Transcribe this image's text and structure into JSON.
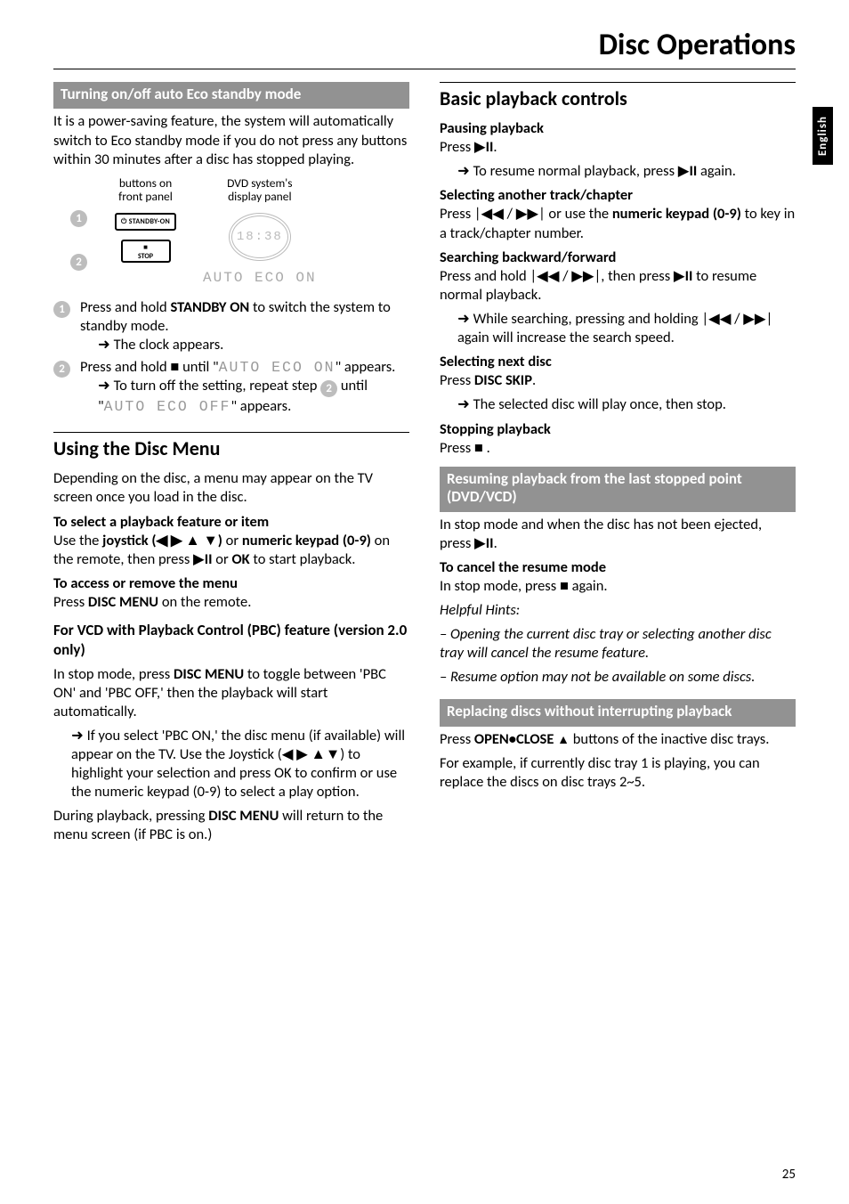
{
  "page_title": "Disc Operations",
  "side_tab": "English",
  "page_number": "25",
  "left": {
    "eco_head": "Turning on/off auto Eco standby mode",
    "eco_intro": "It is a power-saving feature, the system will automatically switch to Eco standby mode if you do not press any buttons within 30 minutes after a disc has stopped playing.",
    "diag_label_left_1": "buttons on",
    "diag_label_left_2": "front panel",
    "diag_label_right_1": "DVD system's",
    "diag_label_right_2": "display panel",
    "standby_btn": "STANDBY-ON",
    "stop_btn_top": "■",
    "stop_btn_bottom": "STOP",
    "clock_display": "18:38",
    "auto_eco_display": "AUTO ECO ON",
    "step1_a": "Press and hold ",
    "step1_b": "STANDBY ON",
    "step1_c": " to switch the system to standby mode.",
    "step1_result": "The clock appears.",
    "step2_a": "Press and hold  ■  until \"",
    "step2_seg": "AUTO ECO ON",
    "step2_b": "\" appears.",
    "step2_result_a": "To turn off the setting, repeat step ",
    "step2_result_b": " until \"",
    "step2_result_seg": "AUTO ECO OFF",
    "step2_result_c": "\" appears.",
    "disc_menu_title": "Using the Disc Menu",
    "dm_intro": "Depending on the disc, a menu may appear on the TV screen once you load in the disc.",
    "dm_select_head": "To select a playback feature or item",
    "dm_select_a": "Use the ",
    "dm_select_joy": "joystick (◀ ▶ ▲ ▼)",
    "dm_select_b": " or ",
    "dm_select_kp": "numeric keypad (0-9)",
    "dm_select_c": " on the remote, then press  ▶",
    "dm_select_d": " or ",
    "dm_select_ok": "OK",
    "dm_select_e": " to start playback.",
    "dm_access_head": "To access or remove the menu",
    "dm_access_a": "Press ",
    "dm_access_b": "DISC MENU",
    "dm_access_c": " on the remote.",
    "pbc_head": "For VCD with Playback Control (PBC) feature (version 2.0 only)",
    "pbc_a": "In stop mode, press ",
    "pbc_b": "DISC MENU",
    "pbc_c": " to toggle between 'PBC ON' and 'PBC OFF,' then the playback will start automatically.",
    "pbc_d": "If you select 'PBC ON,' the disc menu (if available) will appear on the TV.  Use the Joystick (◀ ▶ ▲▼) to highlight your selection and press OK to confirm or use the numeric keypad (0-9) to select a play option.",
    "pbc_e1": "During playback, pressing ",
    "pbc_e2": "DISC MENU",
    "pbc_e3": " will return to the menu screen (if PBC is on.)"
  },
  "right": {
    "basic_title": "Basic playback controls",
    "pause_head": "Pausing playback",
    "pause_a": "Press  ▶",
    "pause_b": ".",
    "pause_c": "To resume normal playback, press ▶",
    "pause_d": " again.",
    "seltrack_head": "Selecting another track/chapter",
    "seltrack_a": "Press ",
    "seltrack_keys": "|◀◀ / ▶▶|",
    "seltrack_b": " or use the ",
    "seltrack_kp": "numeric keypad (0-9)",
    "seltrack_c": " to key in a track/chapter number.",
    "search_head": "Searching backward/forward",
    "search_a": "Press and hold ",
    "search_keys": "|◀◀ / ▶▶|",
    "search_b": ", then press ▶",
    "search_c": " to resume normal playback.",
    "search_d": "While searching, pressing and holding ",
    "search_keys2": "|◀◀ / ▶▶|",
    "search_e": " again will increase the search speed.",
    "next_head": "Selecting next disc",
    "next_a": "Press ",
    "next_b": "DISC SKIP",
    "next_c": ".",
    "next_d": "The selected disc will play once, then stop.",
    "stop_head": "Stopping playback",
    "stop_a": "Press  ■ .",
    "resume_head": "Resuming playback from the last stopped point (DVD/VCD)",
    "resume_a": "In stop mode and when the disc has not been ejected, press  ▶",
    "resume_b": ".",
    "cancel_head": "To cancel the resume mode",
    "cancel_a": "In stop mode, press  ■  again.",
    "hints_head": "Helpful Hints:",
    "hint1": "– Opening the current disc tray or selecting another disc tray will cancel the resume feature.",
    "hint2": "– Resume option may not be available on some discs.",
    "replace_head": "Replacing discs without interrupting playback",
    "replace_a": "Press ",
    "replace_b": "OPEN•CLOSE ",
    "replace_eject": "▲",
    "replace_c": " buttons of the inactive disc trays.",
    "replace_d": "For example, if currently disc tray 1 is playing, you can replace the discs on disc trays 2~5."
  },
  "pause_ii": "II"
}
